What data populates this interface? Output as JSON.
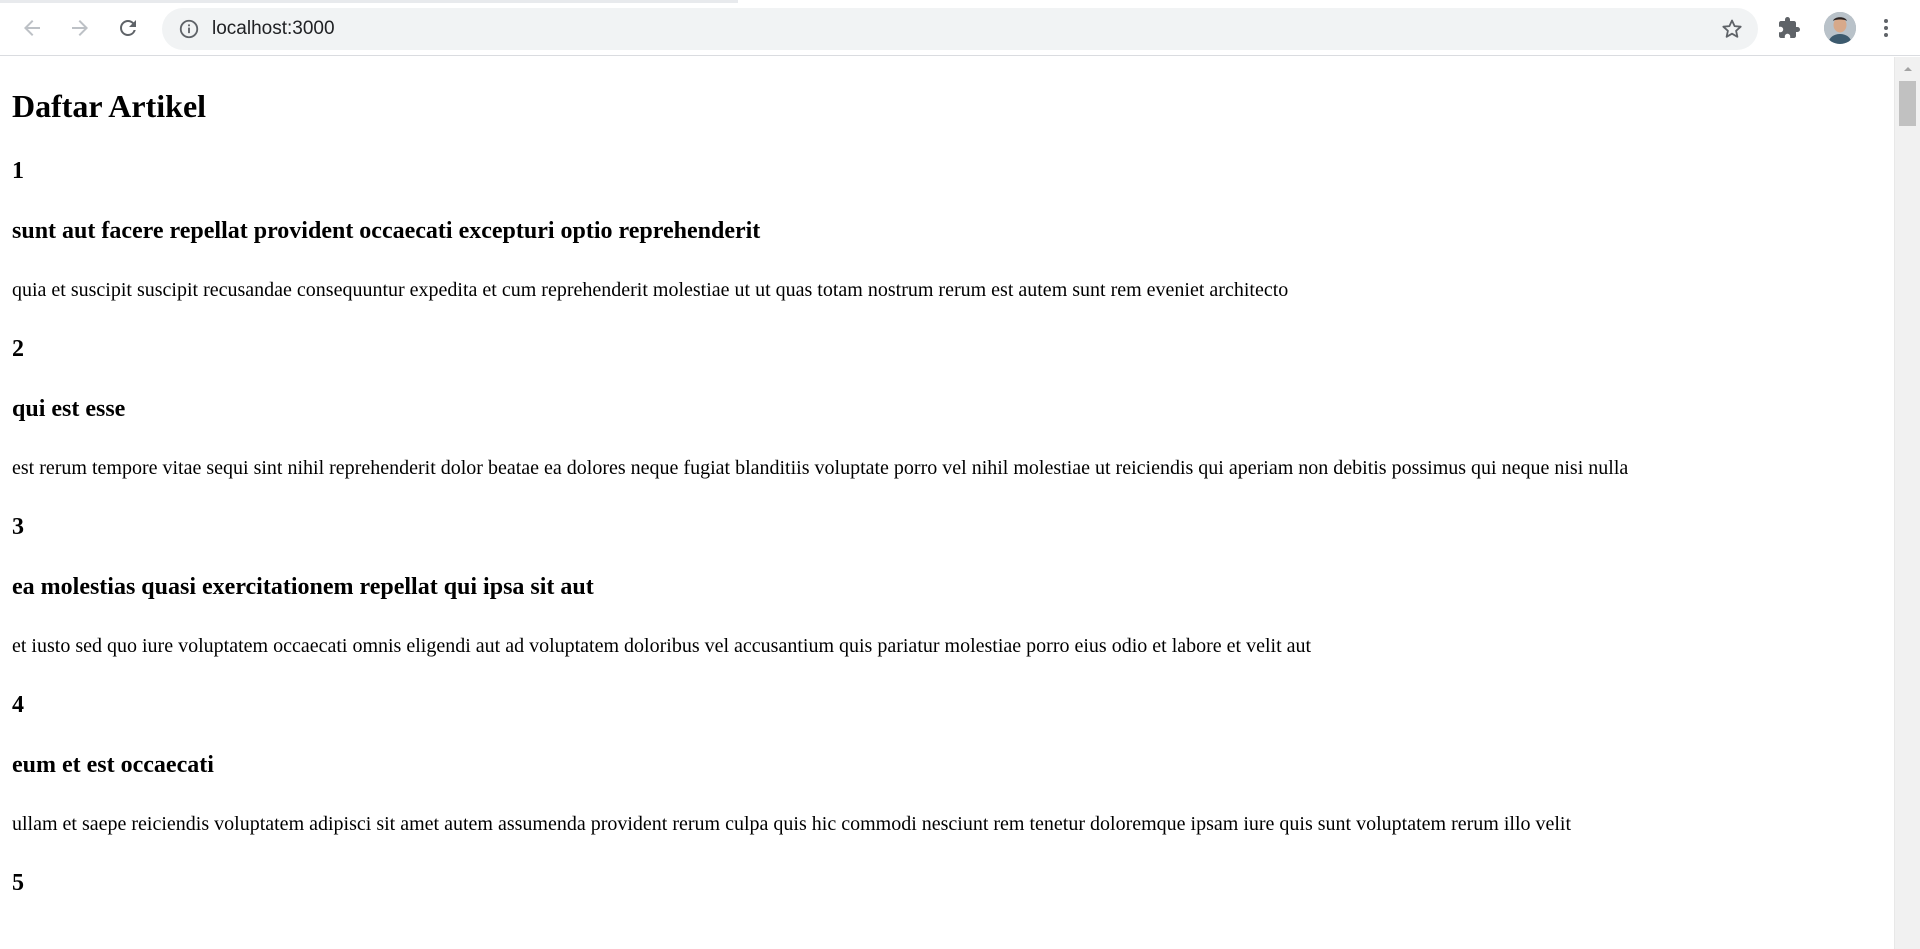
{
  "browser": {
    "url": "localhost:3000",
    "icons": {
      "back": "arrow-left-icon",
      "forward": "arrow-right-icon",
      "reload": "reload-icon",
      "site_info": "info-icon",
      "bookmark": "star-icon",
      "extensions": "puzzle-icon",
      "menu": "kebab-menu-icon"
    }
  },
  "page": {
    "title": "Daftar Artikel",
    "articles": [
      {
        "id": "1",
        "title": "sunt aut facere repellat provident occaecati excepturi optio reprehenderit",
        "body": "quia et suscipit suscipit recusandae consequuntur expedita et cum reprehenderit molestiae ut ut quas totam nostrum rerum est autem sunt rem eveniet architecto"
      },
      {
        "id": "2",
        "title": "qui est esse",
        "body": "est rerum tempore vitae sequi sint nihil reprehenderit dolor beatae ea dolores neque fugiat blanditiis voluptate porro vel nihil molestiae ut reiciendis qui aperiam non debitis possimus qui neque nisi nulla"
      },
      {
        "id": "3",
        "title": "ea molestias quasi exercitationem repellat qui ipsa sit aut",
        "body": "et iusto sed quo iure voluptatem occaecati omnis eligendi aut ad voluptatem doloribus vel accusantium quis pariatur molestiae porro eius odio et labore et velit aut"
      },
      {
        "id": "4",
        "title": "eum et est occaecati",
        "body": "ullam et saepe reiciendis voluptatem adipisci sit amet autem assumenda provident rerum culpa quis hic commodi nesciunt rem tenetur doloremque ipsam iure quis sunt voluptatem rerum illo velit"
      },
      {
        "id": "5"
      }
    ]
  }
}
